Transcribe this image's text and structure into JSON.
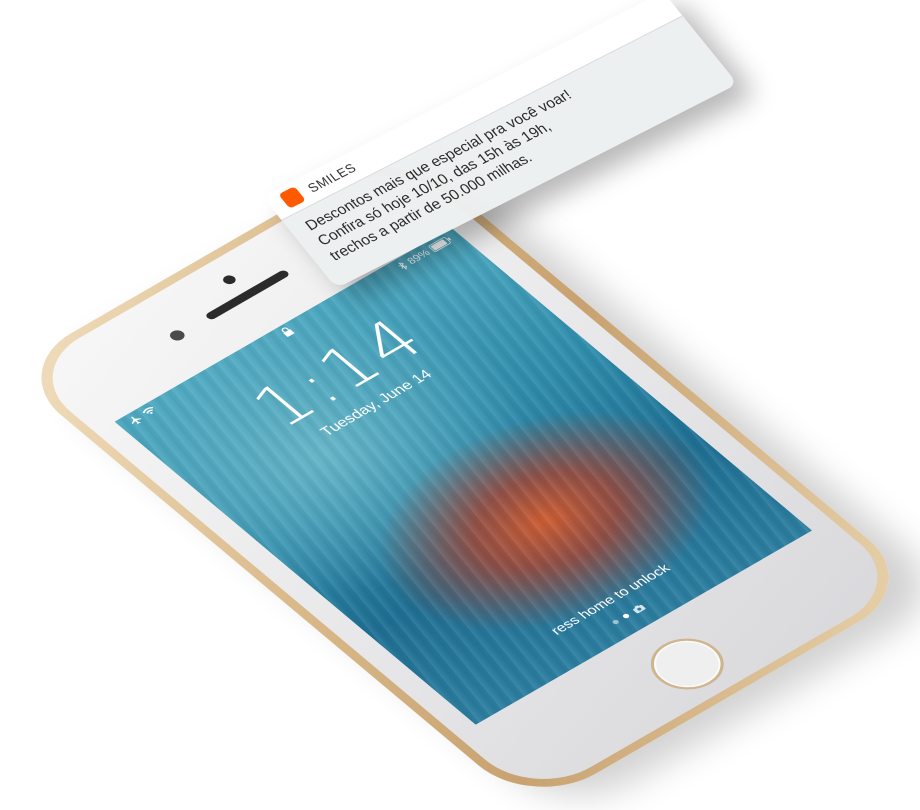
{
  "status_bar": {
    "battery_percent": "89%",
    "icons": [
      "airplane-icon",
      "wifi-icon",
      "lock-icon",
      "bluetooth-icon",
      "battery-icon"
    ]
  },
  "lock_screen": {
    "time": "1:14",
    "date": "Tuesday, June 14",
    "unlock_hint": "ress home to unlock"
  },
  "notification": {
    "app_name": "SMILES",
    "app_icon_color": "#ff5a00",
    "lines": [
      "Descontos mais que especial pra você voar!",
      "Confira só hoje 10/10, das 15h às 19h,",
      "trechos a partir de 50.000 milhas."
    ]
  },
  "colors": {
    "phone_rim": "#d9b888",
    "phone_face": "#e7e7e9",
    "wallpaper_blue": "#2f8cab",
    "wallpaper_orange": "#d65c2e"
  }
}
